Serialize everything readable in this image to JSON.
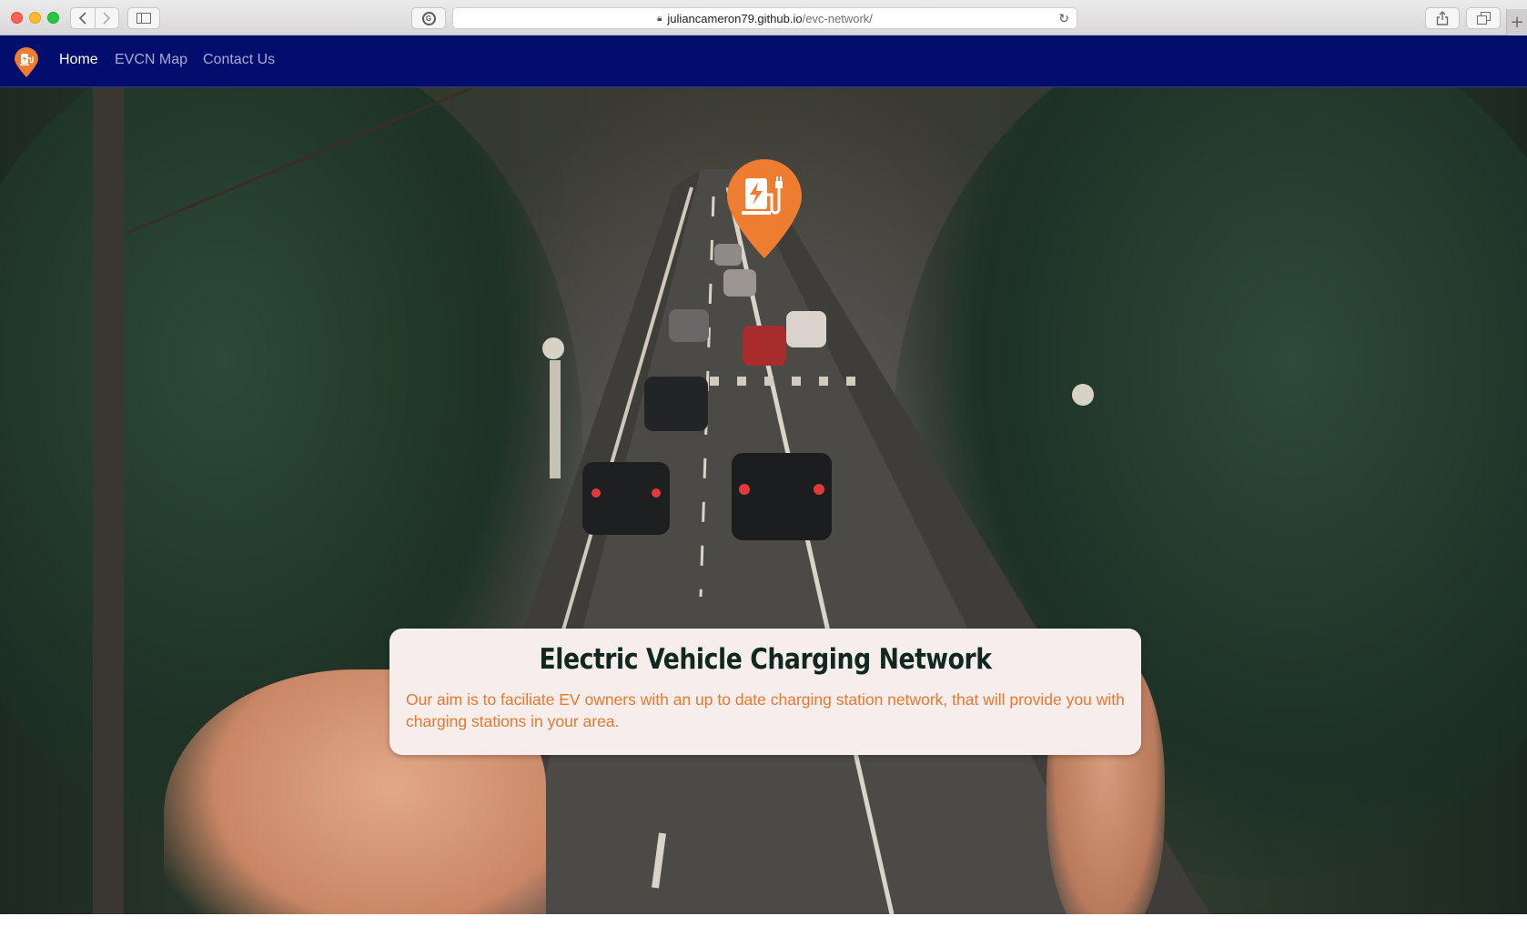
{
  "browser": {
    "url_host": "juliancameron79.github.io",
    "url_path": "/evc-network/",
    "icons": [
      "back-icon",
      "forward-icon",
      "sidebar-icon",
      "grammarly-icon",
      "lock-icon",
      "reload-icon",
      "share-icon",
      "tabs-icon",
      "new-tab-icon"
    ]
  },
  "navbar": {
    "background": "#020e6e",
    "links": [
      {
        "label": "Home",
        "active": true
      },
      {
        "label": "EVCN Map",
        "active": false
      },
      {
        "label": "Contact Us",
        "active": false
      }
    ]
  },
  "hero": {
    "title": "Electric Vehicle Charging Network",
    "description": "Our aim is to faciliate EV owners with an up to date charging station network, that will provide you with charging stations in your area.",
    "accent_color": "#ee7d31",
    "pin_icon": "ev-charger-pin-icon"
  }
}
